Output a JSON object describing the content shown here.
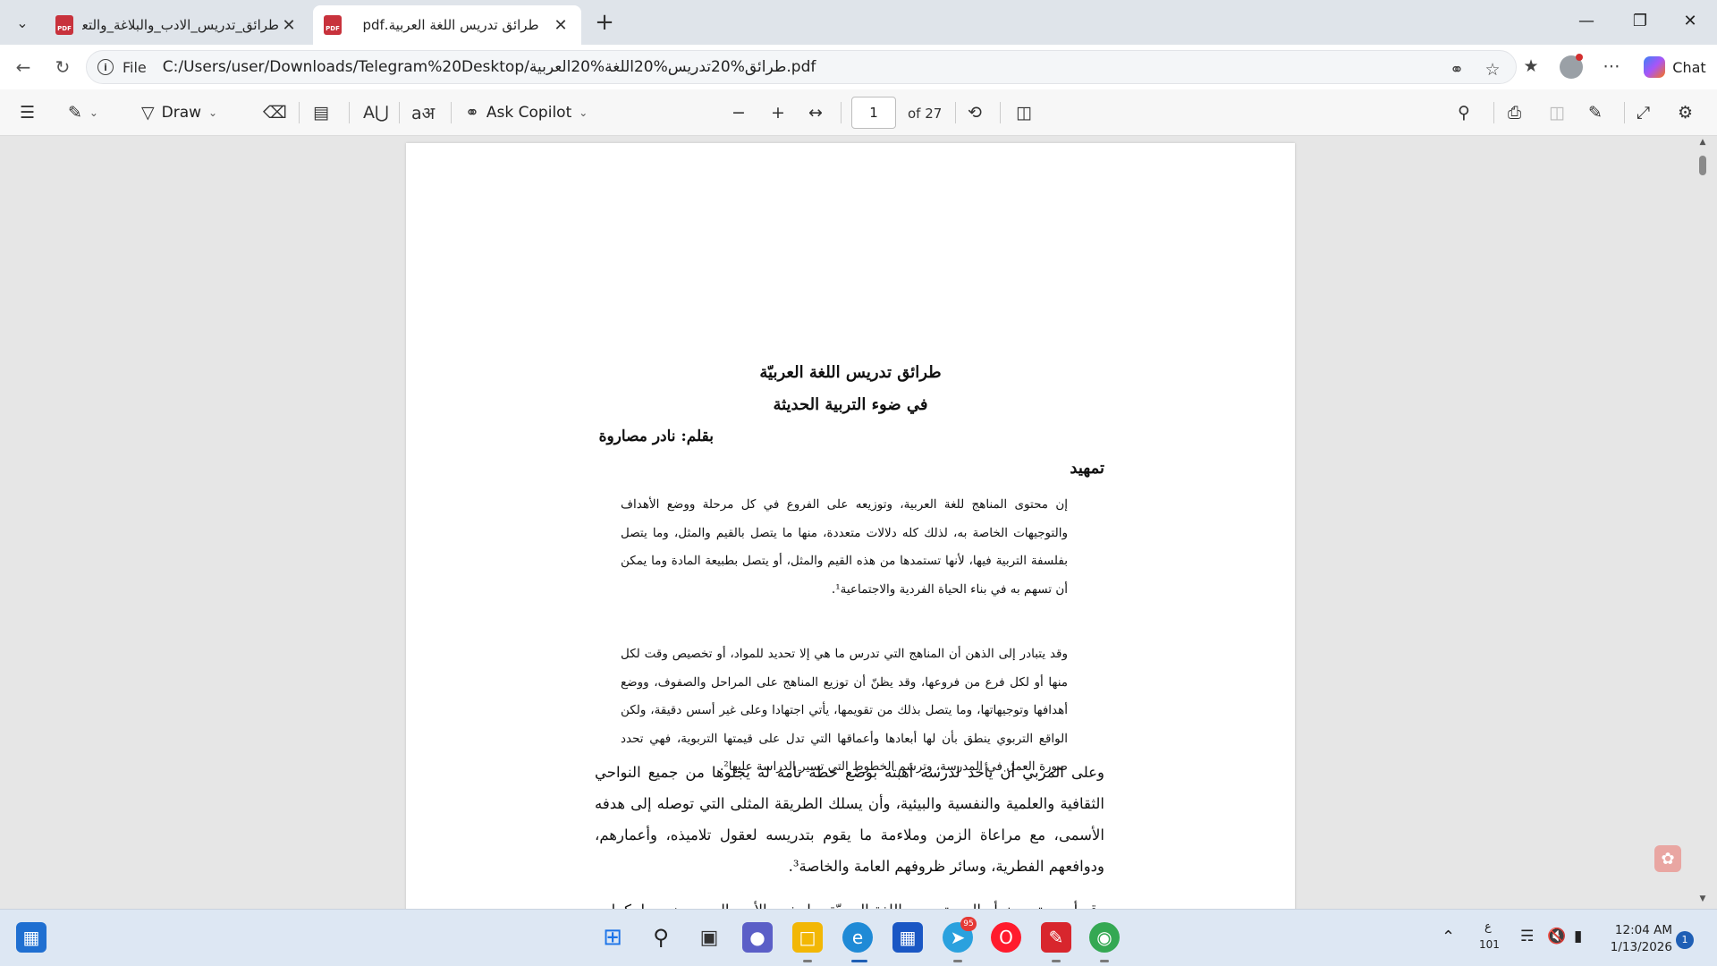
{
  "tabs": [
    {
      "title": "طرائق_تدريس_الادب_والبلاغة_والتعبير",
      "active": false
    },
    {
      "title": "طرائق تدريس اللغة العربية.pdf",
      "active": true
    }
  ],
  "address": {
    "scheme_label": "File",
    "url": "C:/Users/user/Downloads/Telegram%20Desktop/طرائق%20تدريس%20اللغة%20العربية.pdf"
  },
  "chat_label": "Chat",
  "toolbar": {
    "draw_label": "Draw",
    "ask_copilot_label": "Ask Copilot",
    "page_number": "1",
    "page_of": "of 27"
  },
  "document": {
    "title_line1": "طرائق تدريس اللغة العربيّة",
    "title_line2": "في ضوء التربية الحديثة",
    "author": "بقلم: نادر مصاروة",
    "heading": "تمهيد",
    "paragraph1": "إن محتوى المناهج للغة العربية، وتوزيعه على الفروع في كل مرحلة ووضع الأهداف والتوجيهات الخاصة به، لذلك كله دلالات متعددة، منها ما يتصل بالقيم والمثل، وما يتصل بفلسفة التربية فيها، لأنها تستمدها من هذه القيم والمثل، أو يتصل بطبيعة المادة وما يمكن أن تسهم به في بناء الحياة الفردية والاجتماعية¹.",
    "paragraph2": "وقد يتبادر إلى الذهن أن المناهج التي تدرس ما هي إلا تحديد للمواد، أو تخصيص وقت لكل منها أو لكل فرع من فروعها، وقد يظنّ أن توزيع المناهج على المراحل والصفوف، ووضع أهدافها وتوجيهاتها، وما يتصل بذلك من تقويمها، يأتي اجتهادا وعلى غير أسس دقيقة، ولكن الواقع التربوي ينطق بأن لها أبعادها وأعماقها التي تدل على قيمتها التربوية، فهي تحدد صورة العمل في المدرسة، وترسم الخطوط التي تسير الدراسة عليها².",
    "paragraph3": "وعلى المربي أن يأخذ لدرسه أهبته بوضع خطة تامة له يجلوها من جميع النواحي الثقافية والعلمية والنفسية والبيئية، وأن يسلك الطريقة المثلى التي توصله إلى هدفه الأسمى، مع مراعاة الزمن وملاءمة ما يقوم بتدريسه لعقول تلاميذه، وأعمارهم، ودوافعهم الفطرية، وسائر ظروفهم العامة والخاصة³.",
    "paragraph4": "وقد أصبح تحديث أساليب تدريس اللغة العربيّة بما يخدم الأدب العربي ضروريا، كما"
  },
  "taskbar": {
    "telegram_badge": "95",
    "language": "ع",
    "language_sub": "101",
    "time": "12:04 AM",
    "date": "1/13/2026",
    "notification_count": "1"
  },
  "colors": {
    "tabbar_bg": "#dfe4ea",
    "pdf_red": "#c8323c",
    "taskbar_bg": "#dde7f3"
  }
}
